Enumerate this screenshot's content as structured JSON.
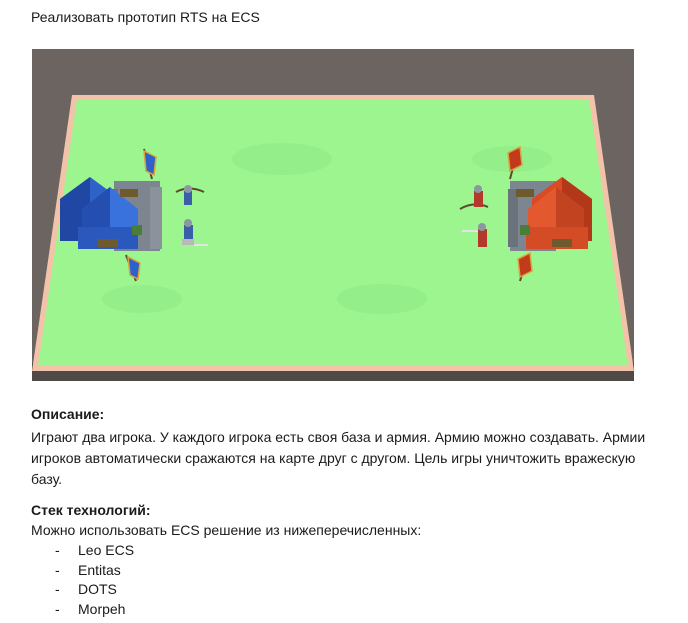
{
  "title": "Реализовать прототип RTS на ECS",
  "scene": {
    "image_label": "RTS ECS prototype scene",
    "colors": {
      "background": "#6b6460",
      "field": "#9cf58f",
      "border": "#f3c3a9",
      "blue_team": "#2f62c9",
      "red_team": "#d94a25"
    }
  },
  "description": {
    "heading": "Описание:",
    "text": "Играют два игрока. У каждого игрока есть своя база и армия. Армию можно создавать. Армии игроков автоматически сражаются на карте друг с другом. Цель игры уничтожить вражескую базу."
  },
  "stack": {
    "heading": "Стек технологий:",
    "intro": "Можно использовать ECS решение из нижеперечисленных:",
    "items": [
      {
        "dash": "-",
        "label": "Leo ECS"
      },
      {
        "dash": "-",
        "label": "Entitas"
      },
      {
        "dash": "-",
        "label": "DOTS"
      },
      {
        "dash": "-",
        "label": "Morpeh"
      }
    ]
  }
}
